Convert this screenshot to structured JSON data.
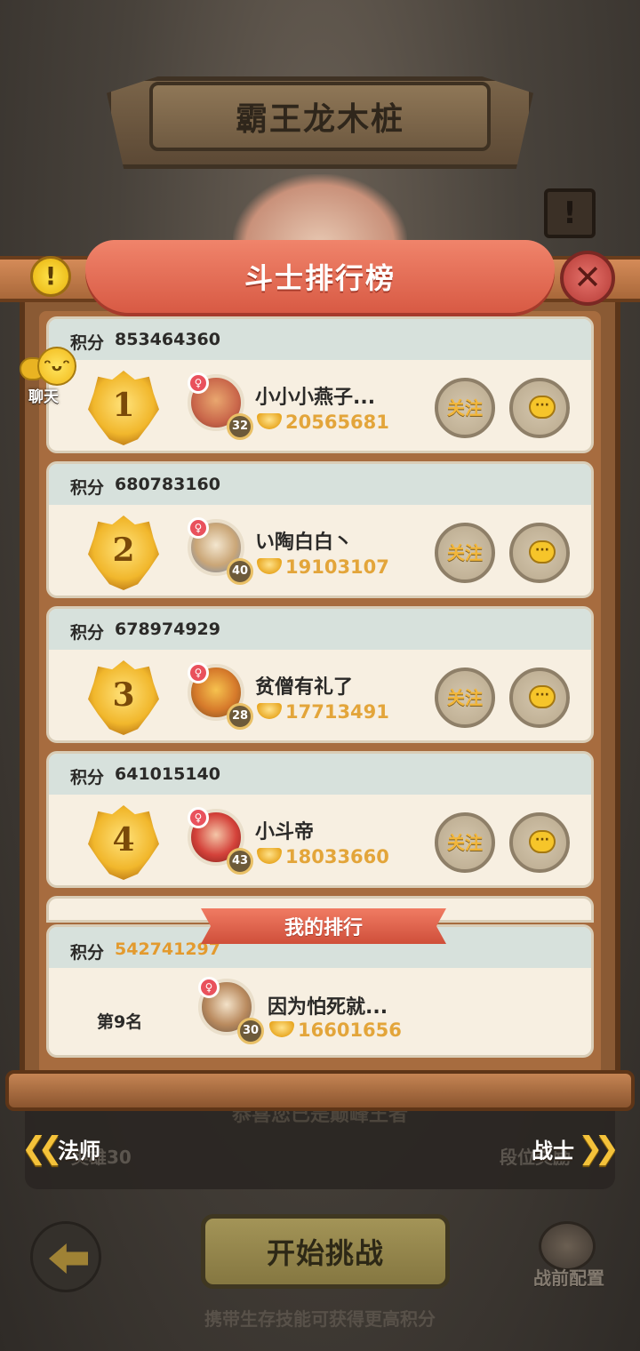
{
  "stage_title": "霸王龙木桩",
  "background": {
    "congrats_text": "恭喜您已是巅峰王者",
    "ghost_left_label": "英雄30",
    "ghost_right_label": "段位奖励"
  },
  "board": {
    "title": "斗士排行榜",
    "info_icon": "!",
    "close_icon": "✕",
    "score_label": "积分",
    "follow_label": "关注",
    "chat_icon": "···"
  },
  "rankings": [
    {
      "rank": "1",
      "score": "853464360",
      "name": "小小小燕子...",
      "level": "32",
      "coins": "20565681"
    },
    {
      "rank": "2",
      "score": "680783160",
      "name": "い陶白白丶",
      "level": "40",
      "coins": "19103107"
    },
    {
      "rank": "3",
      "score": "678974929",
      "name": "贫僧有礼了",
      "level": "28",
      "coins": "17713491"
    },
    {
      "rank": "4",
      "score": "641015140",
      "name": "小斗帝",
      "level": "43",
      "coins": "18033660"
    }
  ],
  "my_rank": {
    "ribbon": "我的排行",
    "score_label": "积分",
    "score": "542741297",
    "rank_text": "第9名",
    "name": "因为怕死就...",
    "level": "30",
    "coins": "16601656"
  },
  "chat_shortcut": {
    "label": "聊天",
    "icon": "chat-face-icon"
  },
  "class_switch": {
    "left_label": "法师",
    "right_label": "战士",
    "left_chevron": "❮❮",
    "right_chevron": "❯❯"
  },
  "controls": {
    "start_label": "开始挑战",
    "preset_label": "战前配置",
    "hint": "携带生存技能可获得更高积分"
  },
  "colors": {
    "accent_gold": "#e3a53a",
    "ribbon_red": "#d85a44",
    "board_wood": "#8a5a34"
  }
}
